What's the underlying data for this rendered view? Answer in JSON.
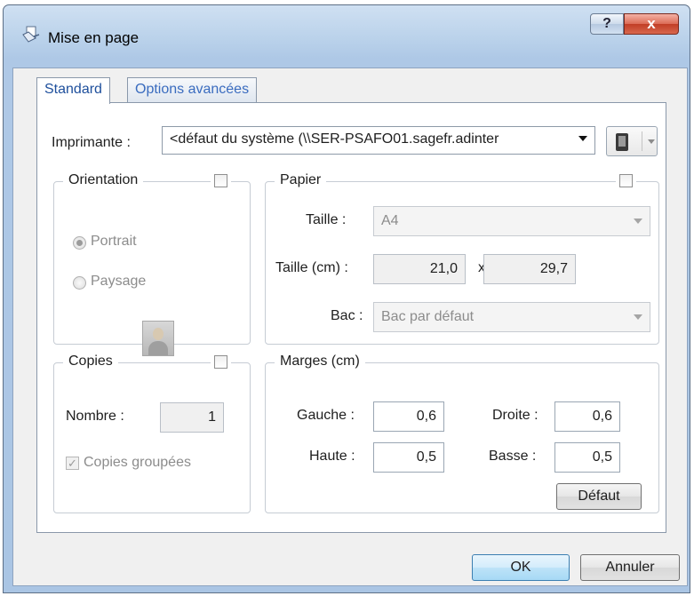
{
  "window": {
    "title": "Mise en page",
    "help_button": "?",
    "close_button": "x"
  },
  "tabs": [
    {
      "label": "Standard"
    },
    {
      "label": "Options avancées"
    }
  ],
  "printer": {
    "label": "Imprimante :",
    "value": "<défaut du système (\\\\SER-PSAFO01.sagefr.adinter"
  },
  "orientation": {
    "title": "Orientation",
    "portrait": "Portrait",
    "paysage": "Paysage"
  },
  "papier": {
    "title": "Papier",
    "taille_label": "Taille :",
    "taille_value": "A4",
    "taille_cm_label": "Taille (cm) :",
    "width": "21,0",
    "x_label": "x",
    "height": "29,7",
    "bac_label": "Bac :",
    "bac_value": "Bac par défaut"
  },
  "copies": {
    "title": "Copies",
    "nombre_label": "Nombre :",
    "nombre_value": "1",
    "groupees": "Copies groupées"
  },
  "marges": {
    "title": "Marges (cm)",
    "gauche_label": "Gauche :",
    "gauche": "0,6",
    "droite_label": "Droite :",
    "droite": "0,6",
    "haute_label": "Haute :",
    "haute": "0,5",
    "basse_label": "Basse :",
    "basse": "0,5",
    "defaut_button": "Défaut"
  },
  "buttons": {
    "ok": "OK",
    "annuler": "Annuler"
  }
}
